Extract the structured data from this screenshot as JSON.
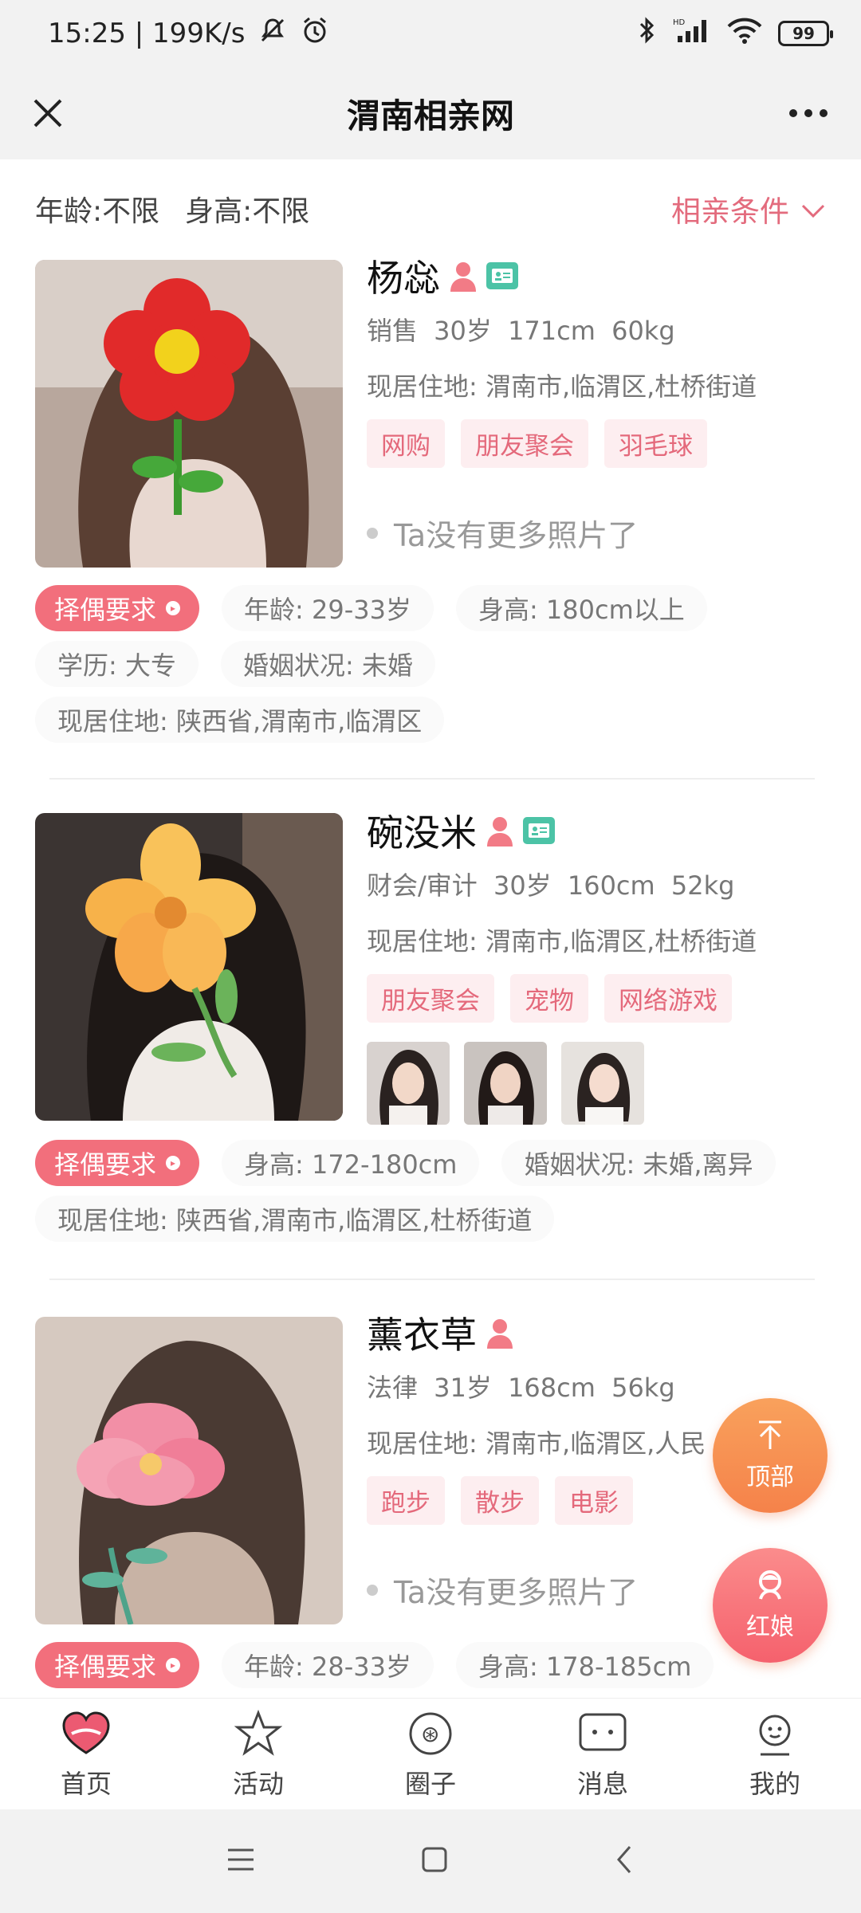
{
  "status_bar": {
    "time_speed": "15:25 | 199K/s",
    "battery": "99"
  },
  "nav": {
    "title": "渭南相亲网"
  },
  "filter": {
    "age": "年龄:不限",
    "height": "身高:不限",
    "conditions": "相亲条件"
  },
  "profiles": [
    {
      "name": "杨惢",
      "meta": "销售 30岁 171cm 60kg",
      "address": "现居住地: 渭南市,临渭区,杜桥街道",
      "tags": [
        "网购",
        "朋友聚会",
        "羽毛球"
      ],
      "no_more_photos": "Ta没有更多照片了",
      "requirements_label": "择偶要求",
      "requirements": [
        "年龄: 29-33岁",
        "身高: 180cm以上",
        "学历: 大专",
        "婚姻状况: 未婚",
        "现居住地: 陕西省,渭南市,临渭区"
      ]
    },
    {
      "name": "碗没米",
      "meta": "财会/审计 30岁 160cm 52kg",
      "address": "现居住地: 渭南市,临渭区,杜桥街道",
      "tags": [
        "朋友聚会",
        "宠物",
        "网络游戏"
      ],
      "requirements_label": "择偶要求",
      "requirements": [
        "身高: 172-180cm",
        "婚姻状况: 未婚,离异",
        "现居住地: 陕西省,渭南市,临渭区,杜桥街道"
      ]
    },
    {
      "name": "薰衣草",
      "meta": "法律 31岁 168cm 56kg",
      "address": "现居住地: 渭南市,临渭区,人民",
      "tags": [
        "跑步",
        "散步",
        "电影"
      ],
      "no_more_photos": "Ta没有更多照片了",
      "requirements_label": "择偶要求",
      "requirements": [
        "年龄: 28-33岁",
        "身高: 178-185cm"
      ]
    }
  ],
  "fab": {
    "top": "顶部",
    "matchmaker": "红娘"
  },
  "tabs": [
    {
      "label": "首页",
      "icon": "heart-icon",
      "active": true
    },
    {
      "label": "活动",
      "icon": "star-icon"
    },
    {
      "label": "圈子",
      "icon": "circle-icon"
    },
    {
      "label": "消息",
      "icon": "message-icon"
    },
    {
      "label": "我的",
      "icon": "profile-icon"
    }
  ],
  "colors": {
    "accent": "#f26f7c",
    "tag_text": "#e4697b",
    "tag_bg": "#fdeef0"
  }
}
